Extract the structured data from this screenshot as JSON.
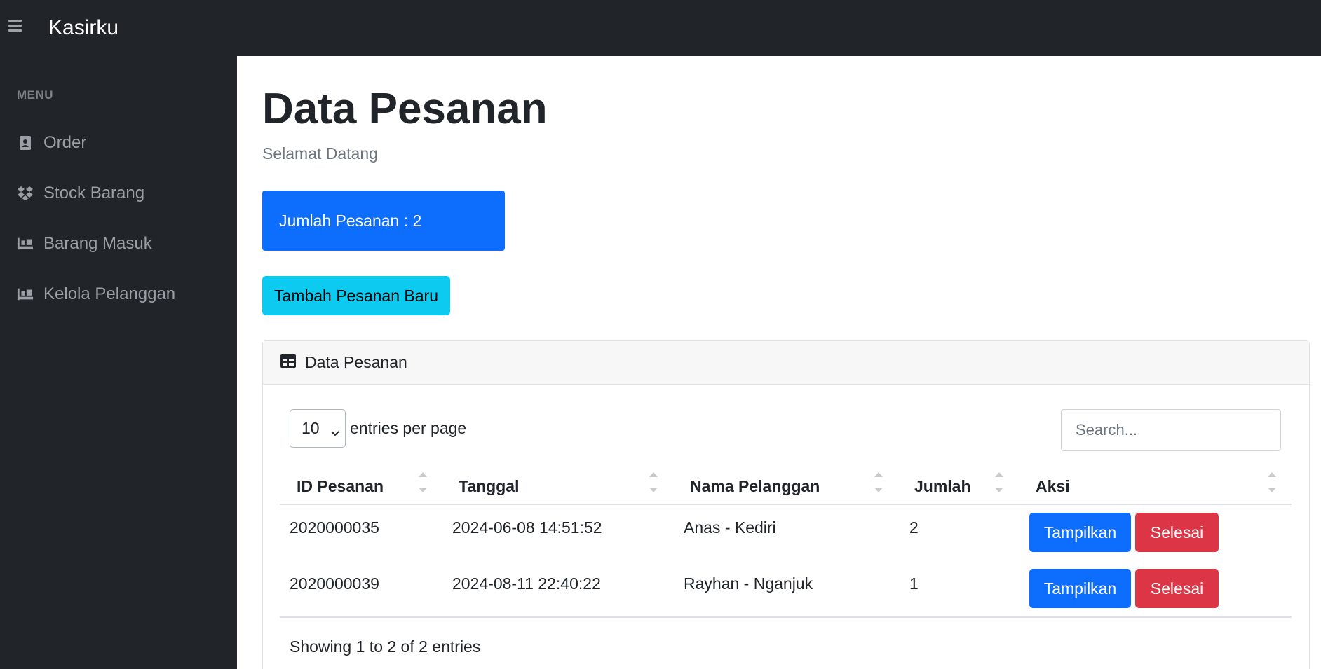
{
  "app": {
    "brand": "Kasirku"
  },
  "sidebar": {
    "heading": "MENU",
    "items": [
      {
        "label": "Order",
        "icon": "address-book-icon"
      },
      {
        "label": "Stock Barang",
        "icon": "dropbox-icon"
      },
      {
        "label": "Barang Masuk",
        "icon": "pallet-icon"
      },
      {
        "label": "Kelola Pelanggan",
        "icon": "pallet-icon"
      }
    ]
  },
  "page": {
    "title": "Data Pesanan",
    "subtitle": "Selamat Datang",
    "stat": "Jumlah Pesanan : 2",
    "add_button": "Tambah Pesanan Baru"
  },
  "card": {
    "header": "Data Pesanan",
    "entries_value": "10",
    "entries_label": "entries per page",
    "search_placeholder": "Search...",
    "columns": [
      "ID Pesanan",
      "Tanggal",
      "Nama Pelanggan",
      "Jumlah",
      "Aksi"
    ],
    "rows": [
      {
        "id": "2020000035",
        "date": "2024-06-08 14:51:52",
        "customer": "Anas - Kediri",
        "qty": "2",
        "view": "Tampilkan",
        "done": "Selesai"
      },
      {
        "id": "2020000039",
        "date": "2024-08-11 22:40:22",
        "customer": "Rayhan - Nganjuk",
        "qty": "1",
        "view": "Tampilkan",
        "done": "Selesai"
      }
    ],
    "footer": "Showing 1 to 2 of 2 entries"
  },
  "colors": {
    "topbar": "#212529",
    "primary": "#0d6efd",
    "info": "#0dcaf0",
    "danger": "#dc3545"
  }
}
